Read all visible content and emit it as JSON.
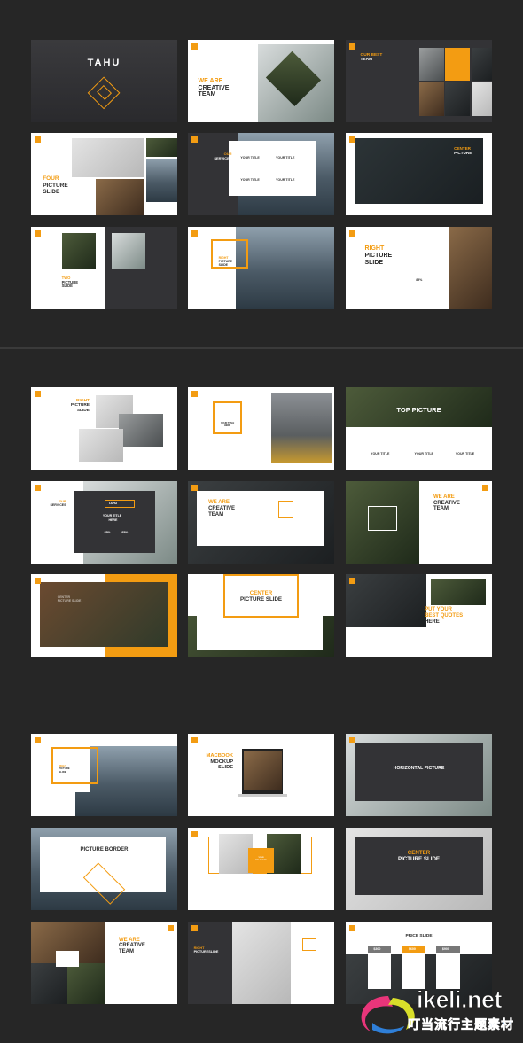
{
  "accent_color": "#f39c12",
  "slides": [
    {
      "theme": "dark",
      "lines": [
        {
          "t": "TAHU",
          "a": false
        }
      ]
    },
    {
      "theme": "light",
      "lines": [
        {
          "t": "WE ARE",
          "a": true
        },
        {
          "t": "CREATIVE",
          "a": false
        },
        {
          "t": "TEAM",
          "a": false
        }
      ]
    },
    {
      "theme": "dark",
      "lines": [
        {
          "t": "OUR BEST",
          "a": true
        },
        {
          "t": "TEAM",
          "a": false
        }
      ]
    },
    {
      "theme": "light",
      "lines": [
        {
          "t": "FOUR",
          "a": true
        },
        {
          "t": "PICTURE",
          "a": false
        },
        {
          "t": "SLIDE",
          "a": false
        }
      ]
    },
    {
      "theme": "dark",
      "lines": [
        {
          "t": "OUR",
          "a": true
        },
        {
          "t": "SERVICES",
          "a": false
        }
      ],
      "labels": [
        "YOUR TITLE",
        "YOUR TITLE",
        "YOUR TITLE",
        "YOUR TITLE"
      ]
    },
    {
      "theme": "light",
      "lines": [
        {
          "t": "CENTER",
          "a": true
        },
        {
          "t": "PICTURE",
          "a": false
        }
      ]
    },
    {
      "theme": "light",
      "lines": [
        {
          "t": "TWO",
          "a": true
        },
        {
          "t": "PICTURE",
          "a": false
        },
        {
          "t": "SLIDE",
          "a": false
        }
      ]
    },
    {
      "theme": "light",
      "lines": [
        {
          "t": "RIGHT",
          "a": true
        },
        {
          "t": "PICTURE",
          "a": false
        },
        {
          "t": "SLIDE",
          "a": false
        }
      ]
    },
    {
      "theme": "light",
      "lines": [
        {
          "t": "RIGHT",
          "a": true
        },
        {
          "t": "PICTURE",
          "a": false
        },
        {
          "t": "SLIDE",
          "a": false
        }
      ],
      "labels": [
        "85%"
      ]
    },
    {
      "theme": "light",
      "lines": [
        {
          "t": "RIGHT",
          "a": true
        },
        {
          "t": "PICTURE",
          "a": false
        },
        {
          "t": "SLIDE",
          "a": false
        }
      ]
    },
    {
      "theme": "light",
      "lines": [
        {
          "t": "YOUR TITLE",
          "a": false
        },
        {
          "t": "HERE",
          "a": false
        }
      ]
    },
    {
      "theme": "light",
      "lines": [
        {
          "t": "TOP PICTURE",
          "a": false
        }
      ],
      "labels": [
        "YOUR TITLE",
        "YOUR TITLE",
        "YOUR TITLE"
      ]
    },
    {
      "theme": "light",
      "lines": [
        {
          "t": "OUR",
          "a": true
        },
        {
          "t": "SERVICES",
          "a": false
        }
      ],
      "labels": [
        "TAHU",
        "YOUR TITLE",
        "HERE",
        "85%",
        "85%"
      ]
    },
    {
      "theme": "light",
      "lines": [
        {
          "t": "WE ARE",
          "a": true
        },
        {
          "t": "CREATIVE",
          "a": false
        },
        {
          "t": "TEAM",
          "a": false
        }
      ]
    },
    {
      "theme": "light",
      "lines": [
        {
          "t": "WE ARE",
          "a": true
        },
        {
          "t": "CREATIVE",
          "a": false
        },
        {
          "t": "TEAM",
          "a": false
        }
      ]
    },
    {
      "theme": "light",
      "lines": [
        {
          "t": "CENTER",
          "a": false
        },
        {
          "t": "PICTURE SLIDE",
          "a": false
        }
      ]
    },
    {
      "theme": "light",
      "lines": [
        {
          "t": "CENTER",
          "a": true
        },
        {
          "t": "PICTURE SLIDE",
          "a": false
        }
      ]
    },
    {
      "theme": "dark",
      "lines": [
        {
          "t": "PUT YOUR",
          "a": true
        },
        {
          "t": "BEST QUOTES",
          "a": true
        },
        {
          "t": "HERE",
          "a": false
        }
      ]
    },
    {
      "theme": "light",
      "lines": [
        {
          "t": "RIGHT",
          "a": true
        },
        {
          "t": "PICTURE",
          "a": false
        },
        {
          "t": "SLIDE",
          "a": false
        }
      ]
    },
    {
      "theme": "light",
      "lines": [
        {
          "t": "MACBOOK",
          "a": true
        },
        {
          "t": "MOCKUP",
          "a": false
        },
        {
          "t": "SLIDE",
          "a": false
        }
      ]
    },
    {
      "theme": "light",
      "lines": [
        {
          "t": "HORIZONTAL PICTURE",
          "a": false
        }
      ]
    },
    {
      "theme": "light",
      "lines": [
        {
          "t": "PICTURE BORDER",
          "a": false
        }
      ]
    },
    {
      "theme": "light",
      "lines": [
        {
          "t": "YOUR",
          "a": false
        },
        {
          "t": "TITLE HERE",
          "a": false
        }
      ]
    },
    {
      "theme": "light",
      "lines": [
        {
          "t": "CENTER",
          "a": true
        },
        {
          "t": "PICTURE SLIDE",
          "a": false
        }
      ]
    },
    {
      "theme": "light",
      "lines": [
        {
          "t": "WE ARE",
          "a": true
        },
        {
          "t": "CREATIVE",
          "a": false
        },
        {
          "t": "TEAM",
          "a": false
        }
      ]
    },
    {
      "theme": "dark",
      "lines": [
        {
          "t": "RIGHT",
          "a": true
        },
        {
          "t": "PICTURESLIDE",
          "a": false
        }
      ]
    },
    {
      "theme": "light",
      "lines": [
        {
          "t": "PRICE SLIDE",
          "a": false
        }
      ],
      "labels": [
        "$300",
        "$600",
        "$900"
      ]
    }
  ],
  "watermark": {
    "brand": "ikeli.net",
    "tagline": "叮当流行主题素材"
  }
}
